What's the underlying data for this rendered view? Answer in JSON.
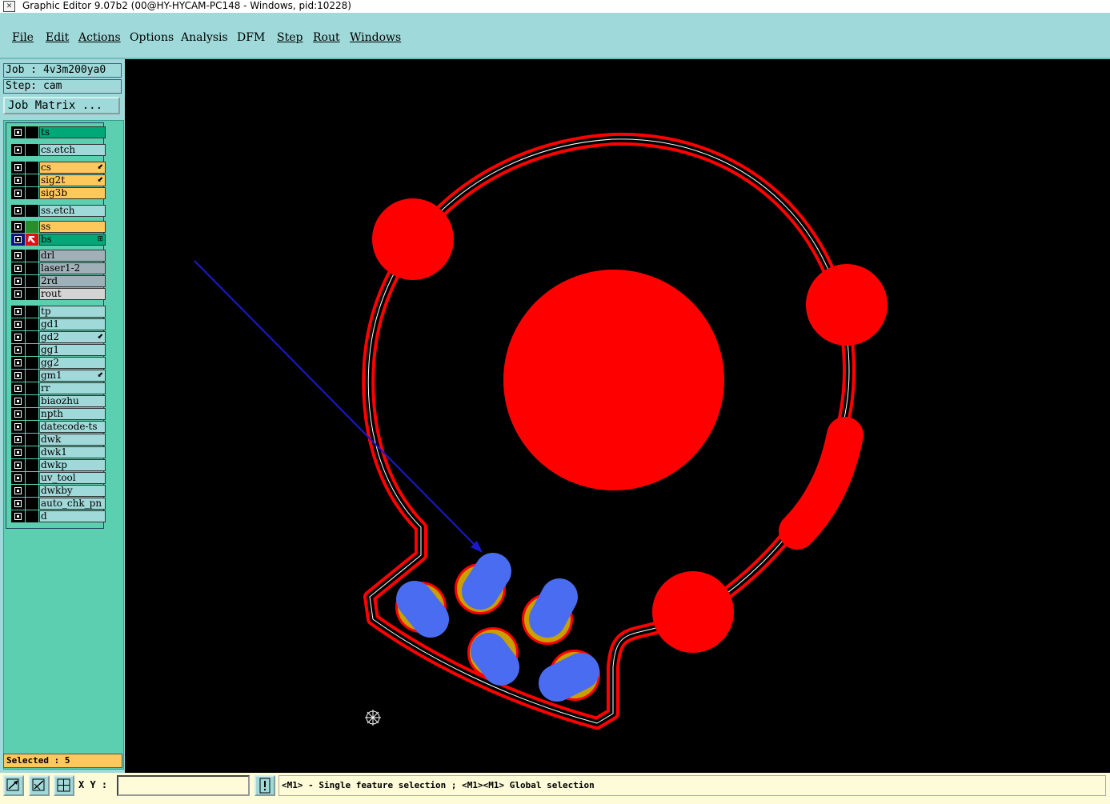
{
  "window": {
    "title": "Graphic Editor 9.07b2 (00@HY-HYCAM-PC148 - Windows, pid:10228)",
    "icon": "app-icon"
  },
  "menu": {
    "items": [
      {
        "label": "File"
      },
      {
        "label": "Edit"
      },
      {
        "label": "Actions"
      },
      {
        "label": "Options"
      },
      {
        "label": "Analysis"
      },
      {
        "label": "DFM"
      },
      {
        "label": "Step"
      },
      {
        "label": "Rout"
      },
      {
        "label": "Windows"
      }
    ]
  },
  "job": {
    "job_line": "Job : 4v3m200ya0",
    "step_line": "Step: cam",
    "matrix_button": "Job Matrix ..."
  },
  "layers": [
    {
      "name": "ts",
      "color": "#00a878"
    },
    {
      "name": "cs.etch",
      "color": "#9fd9d9"
    },
    {
      "name": "cs",
      "color": "#ffc85a",
      "mark": "⬋"
    },
    {
      "name": "sig2t",
      "color": "#ffc85a",
      "mark": "⬋"
    },
    {
      "name": "sig3b",
      "color": "#ffc85a"
    },
    {
      "name": "ss.etch",
      "color": "#9fd9d9"
    },
    {
      "name": "ss",
      "color": "#ffc85a",
      "swatch": "#2b8c2b"
    },
    {
      "name": "bs",
      "color": "#00a878",
      "active": true,
      "mark": "⊞"
    },
    {
      "name": "drl",
      "color": "#a0b0b8"
    },
    {
      "name": "laser1-2",
      "color": "#a0b0b8"
    },
    {
      "name": "2rd",
      "color": "#a0b0b8"
    },
    {
      "name": "rout",
      "color": "#d4d4d4"
    },
    {
      "name": "tp",
      "color": "#9fd9d9"
    },
    {
      "name": "gd1",
      "color": "#9fd9d9"
    },
    {
      "name": "gd2",
      "color": "#9fd9d9",
      "mark": "⬋"
    },
    {
      "name": "gg1",
      "color": "#9fd9d9"
    },
    {
      "name": "gg2",
      "color": "#9fd9d9"
    },
    {
      "name": "gm1",
      "color": "#9fd9d9",
      "mark": "⬋"
    },
    {
      "name": "rr",
      "color": "#9fd9d9"
    },
    {
      "name": "biaozhu",
      "color": "#9fd9d9"
    },
    {
      "name": "npth",
      "color": "#9fd9d9"
    },
    {
      "name": "datecode-ts",
      "color": "#9fd9d9"
    },
    {
      "name": "dwk",
      "color": "#9fd9d9"
    },
    {
      "name": "dwk1",
      "color": "#9fd9d9"
    },
    {
      "name": "dwkp",
      "color": "#9fd9d9"
    },
    {
      "name": "uv_tool",
      "color": "#9fd9d9"
    },
    {
      "name": "dwkby",
      "color": "#9fd9d9"
    },
    {
      "name": "auto_chk_pn",
      "color": "#9fd9d9"
    },
    {
      "name": "d",
      "color": "#9fd9d9"
    }
  ],
  "status": {
    "selected": "Selected : 5"
  },
  "bottombar": {
    "xy_label": "X Y :",
    "xy_value": "",
    "message": "<M1> - Single feature selection ; <M1><M1> Global selection",
    "tools": [
      "zoom-window-icon",
      "measure-icon",
      "grid-icon"
    ],
    "alert_icon": "exclamation-icon"
  },
  "canvas": {
    "background": "#000000",
    "feature_color": "#ff0000",
    "selected_color": "#4a6cf0",
    "pad_ring_color": "#c8a000"
  }
}
